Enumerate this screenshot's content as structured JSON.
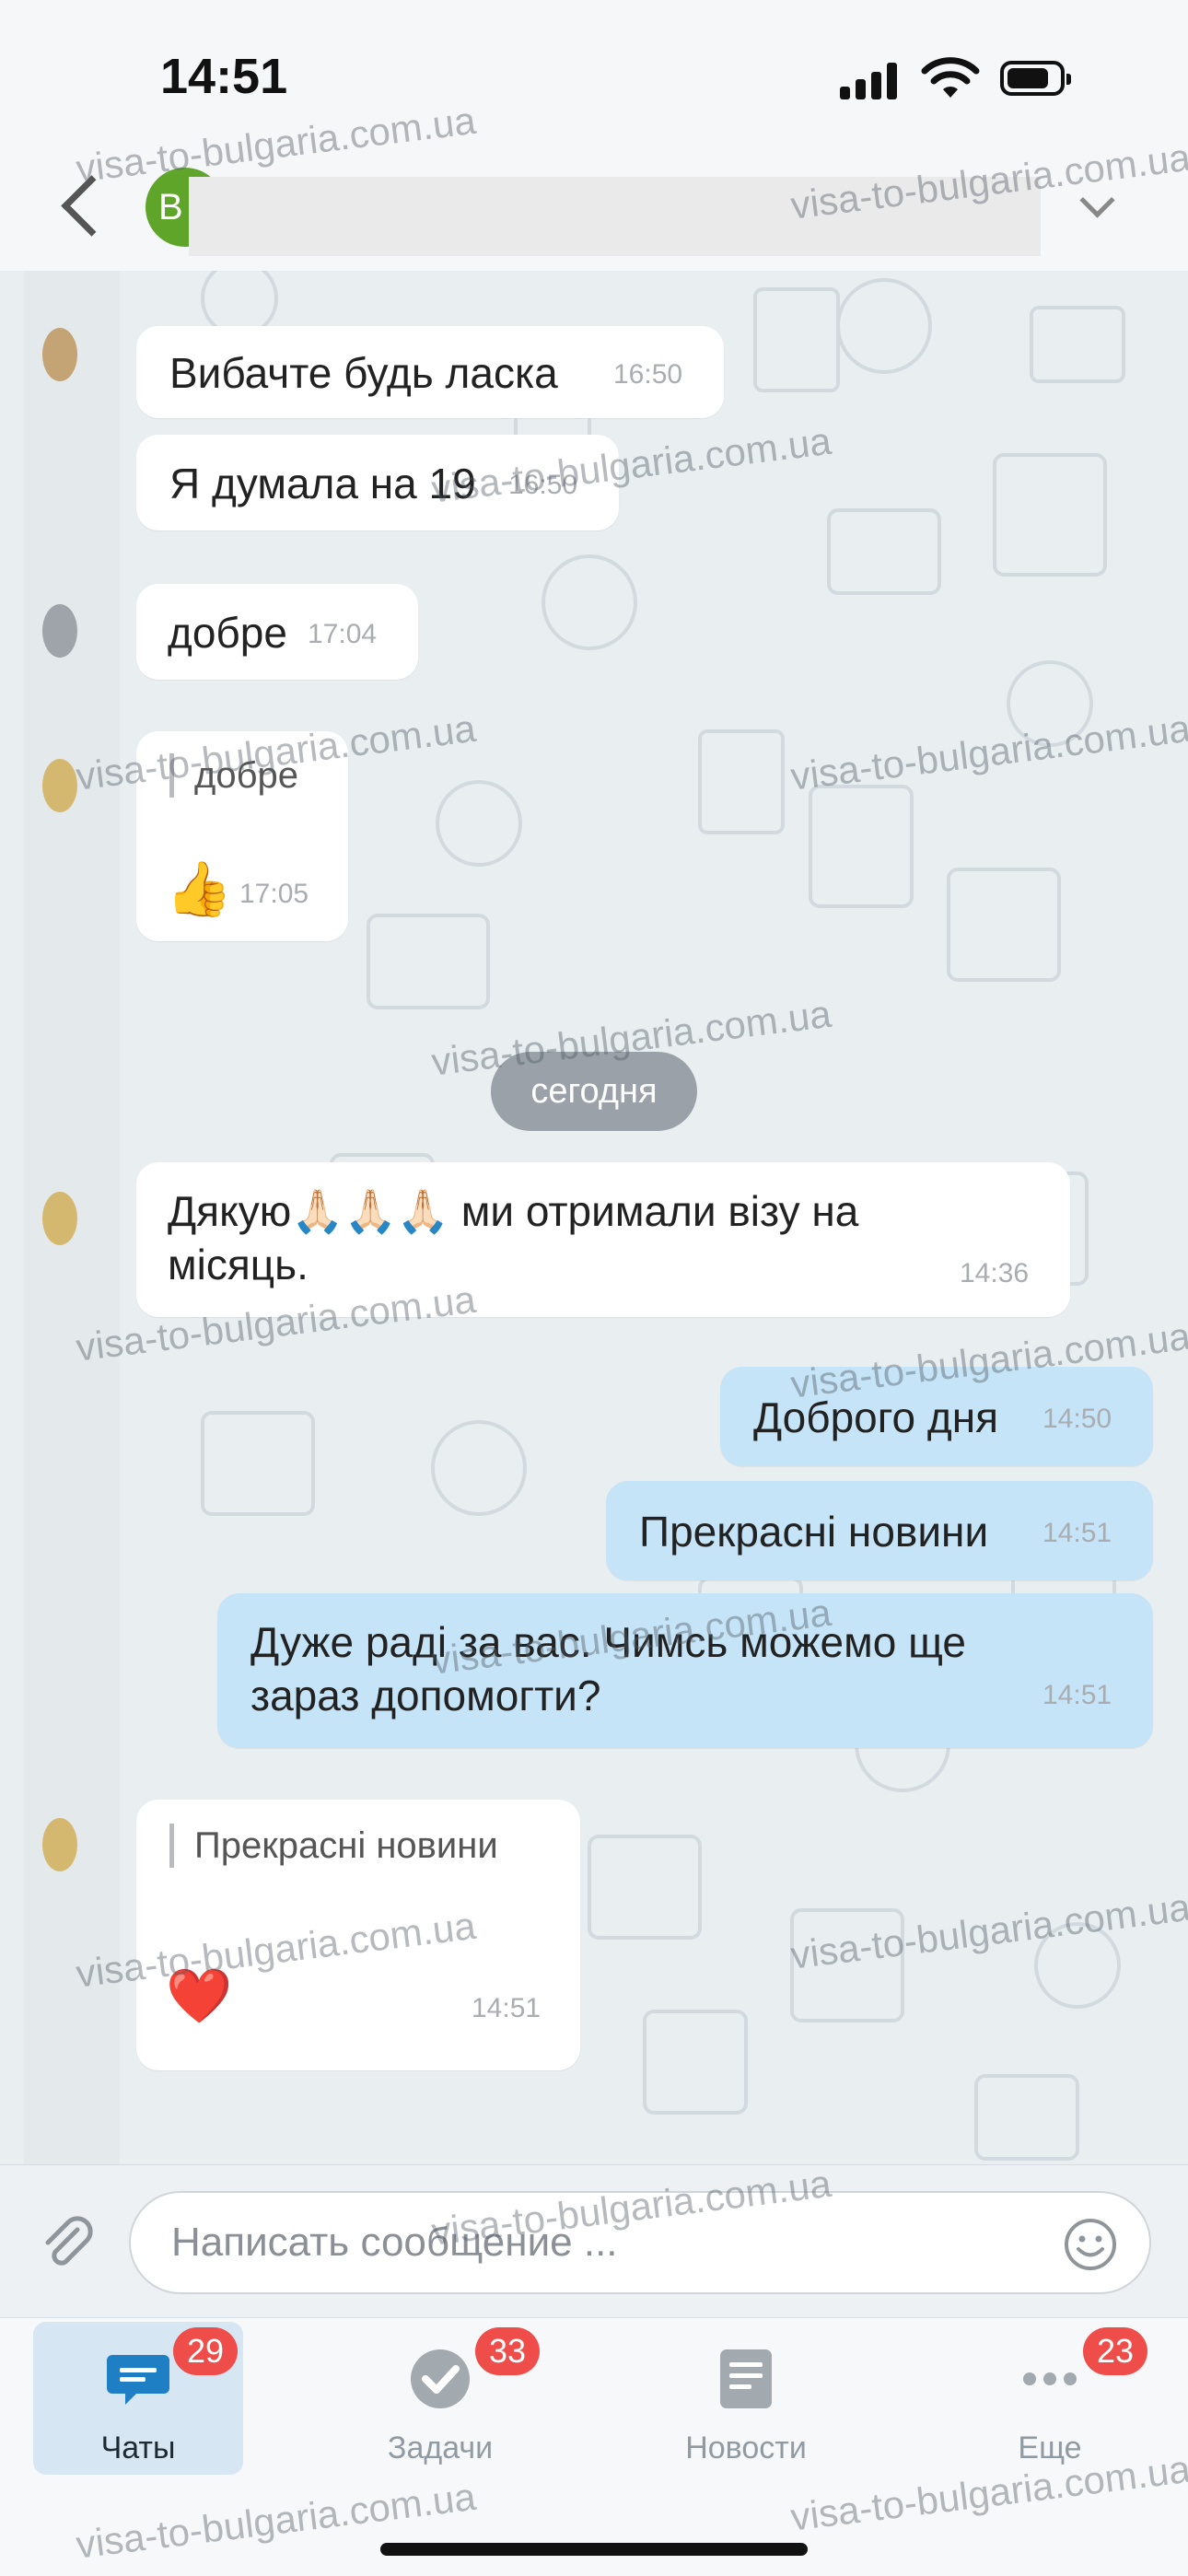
{
  "status_bar": {
    "time": "14:51"
  },
  "header": {
    "avatar_letter": "В"
  },
  "messages": [
    {
      "text": "Вибачте будь ласка",
      "time": "16:50"
    },
    {
      "text": "Я думала на 19",
      "time": "16:50"
    },
    {
      "text": "добре",
      "time": "17:04"
    },
    {
      "quote": "добре",
      "emoji": "👍",
      "time": "17:05"
    },
    {
      "text": "Дякую🙏🏻🙏🏻🙏🏻 ми отримали візу на\nмісяць.",
      "time": "14:36"
    },
    {
      "text": "Доброго дня",
      "time": "14:50"
    },
    {
      "text": "Прекрасні новини",
      "time": "14:51"
    },
    {
      "text": "Дуже раді за вас. Чимсь можемо ще\nзараз допомогти?",
      "time": "14:51"
    },
    {
      "quote": "Прекрасні новини",
      "emoji": "❤️",
      "time": "14:51"
    }
  ],
  "date_separator": "сегодня",
  "input": {
    "placeholder": "Написать сообщение ..."
  },
  "tabs": [
    {
      "label": "Чаты",
      "badge": "29",
      "icon": "chat-icon"
    },
    {
      "label": "Задачи",
      "badge": "33",
      "icon": "tasks-check-icon"
    },
    {
      "label": "Новости",
      "icon": "news-icon"
    },
    {
      "label": "Еще",
      "badge": "23",
      "icon": "more-dots-icon"
    }
  ],
  "watermark": "visa-to-bulgaria.com.ua",
  "watermark_fragment": "visa-to-bulgaria.com.ua",
  "colors": {
    "accent": "#1e7fc4",
    "outgoing_bubble": "#c5e4f7",
    "badge": "#ef4d4a"
  }
}
